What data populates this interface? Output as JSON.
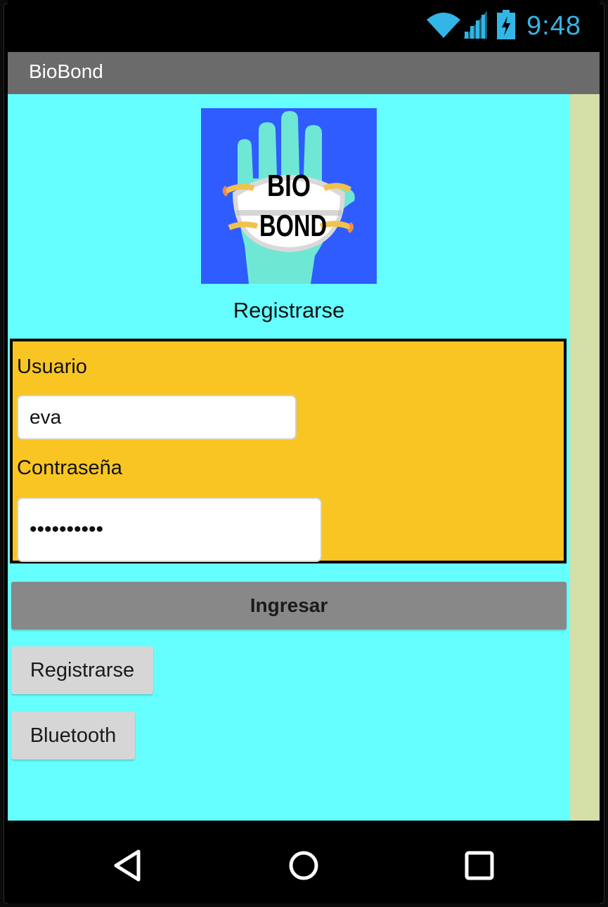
{
  "status_bar": {
    "time": "9:48",
    "icons": [
      "wifi-icon",
      "signal-icon",
      "battery-charging-icon"
    ],
    "accent_color": "#33b5e5"
  },
  "action_bar": {
    "title": "BioBond"
  },
  "logo": {
    "line1": "BIO",
    "line2": "BOND"
  },
  "header": {
    "label": "Registrarse"
  },
  "form": {
    "username_label": "Usuario",
    "username_value": "eva",
    "password_label": "Contraseña",
    "password_value": "••••••••••"
  },
  "buttons": {
    "login": "Ingresar",
    "register": "Registrarse",
    "bluetooth": "Bluetooth"
  },
  "nav_bar": {
    "icons": [
      "back-icon",
      "home-icon",
      "recents-icon"
    ]
  },
  "colors": {
    "content_bg": "#66ffff",
    "form_bg": "#f8c523",
    "action_bar_bg": "#6b6b6b",
    "logo_bg": "#2f5cff"
  }
}
